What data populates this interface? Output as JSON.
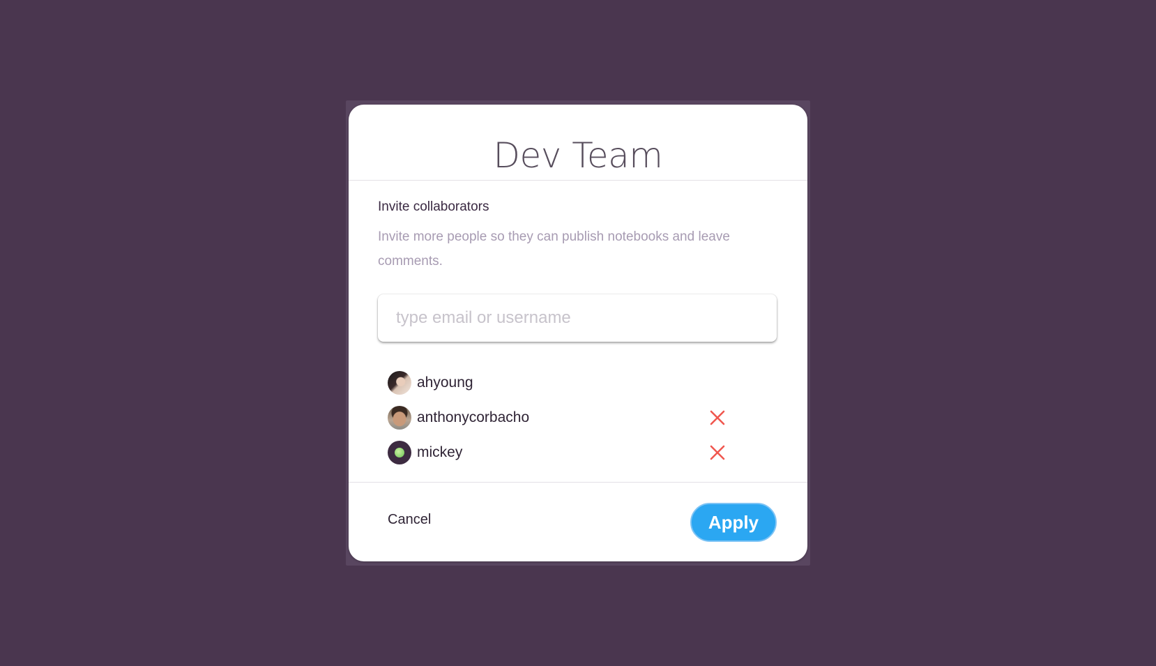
{
  "dialog": {
    "title": "Dev Team",
    "section_heading": "Invite collaborators",
    "section_description": "Invite more people so they can publish notebooks and leave comments.",
    "invite_input": {
      "value": "",
      "placeholder": "type email or username"
    },
    "collaborators": [
      {
        "username": "ahyoung",
        "avatar": "photo-avatar",
        "removable": false
      },
      {
        "username": "anthonycorbacho",
        "avatar": "photo-avatar",
        "removable": true,
        "remove_icon": "close-icon"
      },
      {
        "username": "mickey",
        "avatar": "green-dot-avatar",
        "removable": true,
        "remove_icon": "close-icon"
      }
    ],
    "footer": {
      "cancel_label": "Cancel",
      "apply_label": "Apply"
    }
  },
  "colors": {
    "backdrop": "#4a364f",
    "primary": "#2ba7f2",
    "remove": "#f0574f",
    "muted_text": "#a79bb2"
  }
}
